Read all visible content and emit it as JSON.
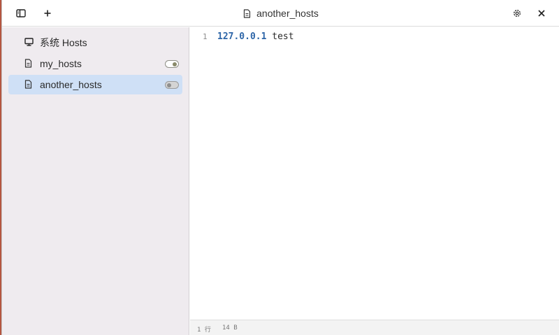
{
  "titlebar": {
    "title": "another_hosts",
    "icons": {
      "sidebar_toggle": "sidebar-layout-icon",
      "add": "plus-icon",
      "settings": "gear-icon",
      "close": "close-icon"
    }
  },
  "sidebar": {
    "items": [
      {
        "label": "系统 Hosts",
        "icon": "monitor-icon",
        "toggle": null,
        "active": false
      },
      {
        "label": "my_hosts",
        "icon": "file-icon",
        "toggle": "on",
        "active": false
      },
      {
        "label": "another_hosts",
        "icon": "file-icon",
        "toggle": "off",
        "active": true
      }
    ]
  },
  "editor": {
    "lines": [
      {
        "number": "1",
        "ip": "127.0.0.1",
        "host": " test"
      }
    ]
  },
  "statusbar": {
    "lines": "1 行",
    "size": "14 B"
  },
  "colors": {
    "sidebar_bg": "#efebef",
    "active_item_bg": "#cfe0f6",
    "ip_color": "#2e66a8"
  }
}
